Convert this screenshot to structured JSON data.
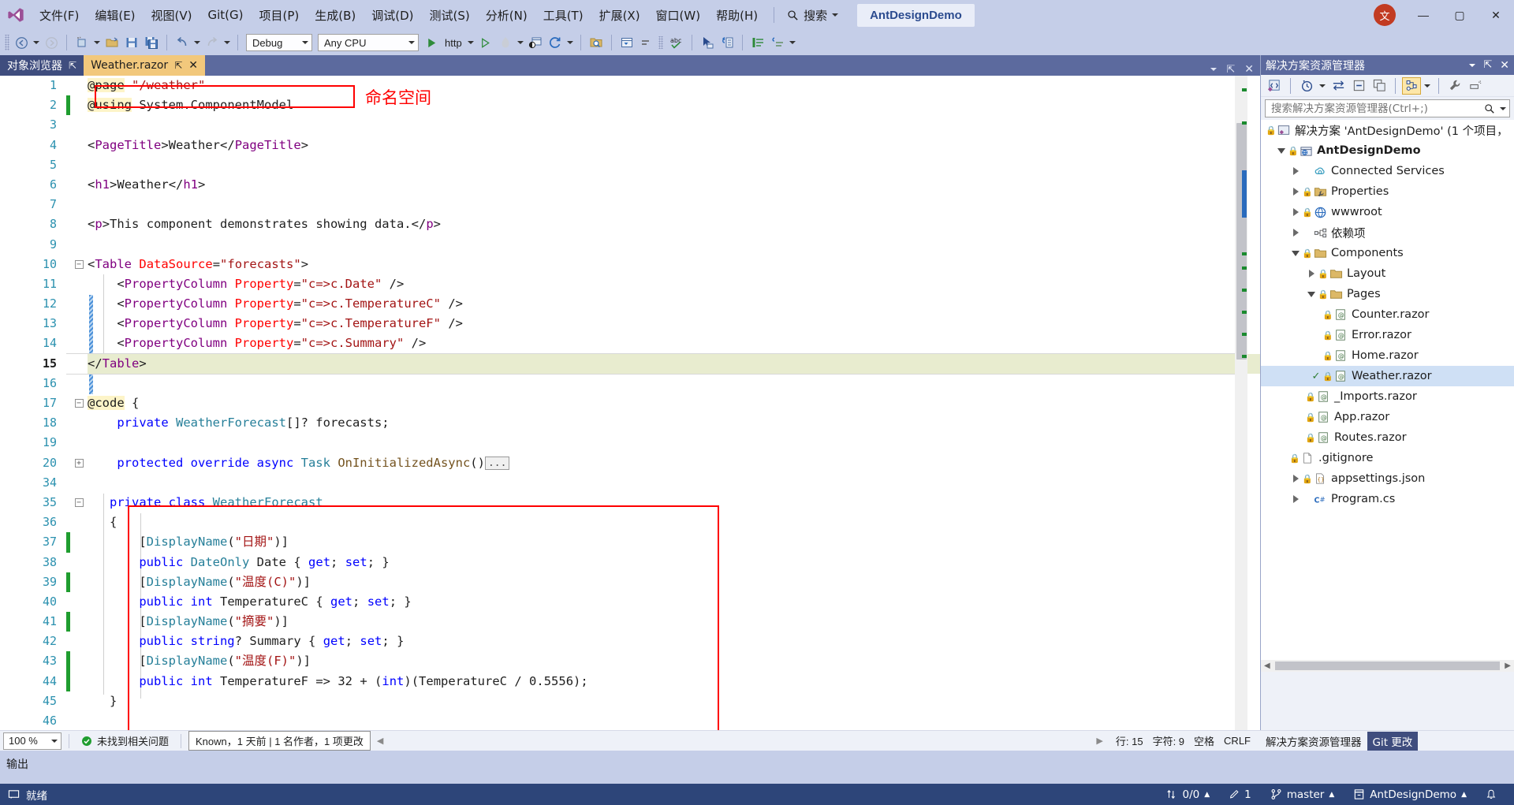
{
  "titlebar": {
    "menus": [
      {
        "label": "文件(F)"
      },
      {
        "label": "编辑(E)"
      },
      {
        "label": "视图(V)"
      },
      {
        "label": "Git(G)"
      },
      {
        "label": "项目(P)"
      },
      {
        "label": "生成(B)"
      },
      {
        "label": "调试(D)"
      },
      {
        "label": "测试(S)"
      },
      {
        "label": "分析(N)"
      },
      {
        "label": "工具(T)"
      },
      {
        "label": "扩展(X)"
      },
      {
        "label": "窗口(W)"
      },
      {
        "label": "帮助(H)"
      }
    ],
    "search_label": "搜索",
    "solution_chip": "AntDesignDemo",
    "user_initial": "文",
    "minimize": "—",
    "maximize": "▢",
    "close": "✕"
  },
  "toolbar": {
    "configuration": "Debug",
    "platform": "Any CPU",
    "run_target": "http"
  },
  "tabs": [
    {
      "label": "对象浏览器",
      "state": "inactive",
      "pin": "⇱",
      "close": ""
    },
    {
      "label": "Weather.razor",
      "state": "active",
      "pin": "⇱",
      "close": "✕"
    }
  ],
  "code": {
    "lines": [
      {
        "n": "1",
        "changed": false,
        "fold": "",
        "text": "@page \"/weather\""
      },
      {
        "n": "2",
        "changed": true,
        "fold": "",
        "text": "@using System.ComponentModel"
      },
      {
        "n": "3",
        "changed": false,
        "fold": "",
        "text": ""
      },
      {
        "n": "4",
        "changed": false,
        "fold": "",
        "text": "<PageTitle>Weather</PageTitle>"
      },
      {
        "n": "5",
        "changed": false,
        "fold": "",
        "text": ""
      },
      {
        "n": "6",
        "changed": false,
        "fold": "",
        "text": "<h1>Weather</h1>"
      },
      {
        "n": "7",
        "changed": false,
        "fold": "",
        "text": ""
      },
      {
        "n": "8",
        "changed": false,
        "fold": "",
        "text": "<p>This component demonstrates showing data.</p>"
      },
      {
        "n": "9",
        "changed": false,
        "fold": "",
        "text": ""
      },
      {
        "n": "10",
        "changed": false,
        "fold": "minus",
        "text": "<Table DataSource=\"forecasts\">"
      },
      {
        "n": "11",
        "changed": false,
        "fold": "",
        "text": "    <PropertyColumn Property=\"c=>c.Date\" />"
      },
      {
        "n": "12",
        "changed": false,
        "fold": "",
        "text": "    <PropertyColumn Property=\"c=>c.TemperatureC\" />"
      },
      {
        "n": "13",
        "changed": false,
        "fold": "",
        "text": "    <PropertyColumn Property=\"c=>c.TemperatureF\" />"
      },
      {
        "n": "14",
        "changed": false,
        "fold": "",
        "text": "    <PropertyColumn Property=\"c=>c.Summary\" />"
      },
      {
        "n": "15",
        "changed": false,
        "fold": "",
        "text": "</Table>"
      },
      {
        "n": "16",
        "changed": false,
        "fold": "",
        "text": ""
      },
      {
        "n": "17",
        "changed": false,
        "fold": "minus",
        "text": "@code {"
      },
      {
        "n": "18",
        "changed": false,
        "fold": "",
        "text": "    private WeatherForecast[]? forecasts;"
      },
      {
        "n": "19",
        "changed": false,
        "fold": "",
        "text": ""
      },
      {
        "n": "20",
        "changed": false,
        "fold": "plus",
        "text": "    protected override async Task OnInitializedAsync()..."
      },
      {
        "n": "34",
        "changed": false,
        "fold": "",
        "text": ""
      },
      {
        "n": "35",
        "changed": false,
        "fold": "minus",
        "text": "    private class WeatherForecast"
      },
      {
        "n": "36",
        "changed": false,
        "fold": "",
        "text": "    {"
      },
      {
        "n": "37",
        "changed": true,
        "fold": "",
        "text": "        [DisplayName(\"日期\")]"
      },
      {
        "n": "38",
        "changed": false,
        "fold": "",
        "text": "        public DateOnly Date { get; set; }"
      },
      {
        "n": "39",
        "changed": true,
        "fold": "",
        "text": "        [DisplayName(\"温度(C)\")]"
      },
      {
        "n": "40",
        "changed": false,
        "fold": "",
        "text": "        public int TemperatureC { get; set; }"
      },
      {
        "n": "41",
        "changed": true,
        "fold": "",
        "text": "        [DisplayName(\"摘要\")]"
      },
      {
        "n": "42",
        "changed": false,
        "fold": "",
        "text": "        public string? Summary { get; set; }"
      },
      {
        "n": "43",
        "changed": true,
        "fold": "",
        "text": "        [DisplayName(\"温度(F)\")]"
      },
      {
        "n": "44",
        "changed": true,
        "fold": "",
        "text": "        public int TemperatureF => 32 + (int)(TemperatureC / 0.5556);"
      },
      {
        "n": "45",
        "changed": false,
        "fold": "",
        "text": "    }"
      },
      {
        "n": "46",
        "changed": false,
        "fold": "",
        "text": ""
      }
    ]
  },
  "annotations": {
    "namespace_note": "命名空间"
  },
  "editor_status": {
    "zoom": "100 %",
    "issues": "未找到相关问题",
    "git_known": "Known，1 天前 | 1 名作者，1 项更改",
    "line": "行: 15",
    "column": "字符: 9",
    "spaces": "空格",
    "line_ending": "CRLF"
  },
  "solution_explorer": {
    "title": "解决方案资源管理器",
    "search_placeholder": "搜索解决方案资源管理器(Ctrl+;)",
    "tree": [
      {
        "indent": 0,
        "twisty": "none",
        "lock": true,
        "icon": "solution-icon",
        "label": "解决方案 'AntDesignDemo' (1 个项目，",
        "bold": false,
        "selected": false
      },
      {
        "indent": 1,
        "twisty": "open",
        "lock": true,
        "icon": "web-project-icon",
        "label": "AntDesignDemo",
        "bold": true,
        "selected": false
      },
      {
        "indent": 2,
        "twisty": "closed",
        "lock": false,
        "icon": "cloud-icon",
        "label": "Connected Services",
        "bold": false,
        "selected": false
      },
      {
        "indent": 2,
        "twisty": "closed",
        "lock": true,
        "icon": "properties-icon",
        "label": "Properties",
        "bold": false,
        "selected": false
      },
      {
        "indent": 2,
        "twisty": "closed",
        "lock": true,
        "icon": "globe-icon",
        "label": "wwwroot",
        "bold": false,
        "selected": false
      },
      {
        "indent": 2,
        "twisty": "closed",
        "lock": false,
        "icon": "dependencies-icon",
        "label": "依赖项",
        "bold": false,
        "selected": false
      },
      {
        "indent": 2,
        "twisty": "open",
        "lock": true,
        "icon": "folder-icon",
        "label": "Components",
        "bold": false,
        "selected": false
      },
      {
        "indent": 3,
        "twisty": "closed",
        "lock": true,
        "icon": "folder-icon",
        "label": "Layout",
        "bold": false,
        "selected": false
      },
      {
        "indent": 3,
        "twisty": "open",
        "lock": true,
        "icon": "folder-icon",
        "label": "Pages",
        "bold": false,
        "selected": false
      },
      {
        "indent": 4,
        "twisty": "none",
        "lock": true,
        "icon": "razor-icon",
        "label": "Counter.razor",
        "bold": false,
        "selected": false
      },
      {
        "indent": 4,
        "twisty": "none",
        "lock": true,
        "icon": "razor-icon",
        "label": "Error.razor",
        "bold": false,
        "selected": false
      },
      {
        "indent": 4,
        "twisty": "none",
        "lock": true,
        "icon": "razor-icon",
        "label": "Home.razor",
        "bold": false,
        "selected": false
      },
      {
        "indent": 4,
        "twisty": "none",
        "lock": true,
        "icon": "razor-icon",
        "label": "Weather.razor",
        "bold": false,
        "selected": true
      },
      {
        "indent": 3,
        "twisty": "none",
        "lock": true,
        "icon": "razor-icon",
        "label": "_Imports.razor",
        "bold": false,
        "selected": false
      },
      {
        "indent": 3,
        "twisty": "none",
        "lock": true,
        "icon": "razor-icon",
        "label": "App.razor",
        "bold": false,
        "selected": false
      },
      {
        "indent": 3,
        "twisty": "none",
        "lock": true,
        "icon": "razor-icon",
        "label": "Routes.razor",
        "bold": false,
        "selected": false
      },
      {
        "indent": 2,
        "twisty": "none",
        "lock": true,
        "icon": "file-icon",
        "label": ".gitignore",
        "bold": false,
        "selected": false
      },
      {
        "indent": 2,
        "twisty": "closed",
        "lock": true,
        "icon": "json-icon",
        "label": "appsettings.json",
        "bold": false,
        "selected": false
      },
      {
        "indent": 2,
        "twisty": "closed",
        "lock": false,
        "icon": "csharp-icon",
        "label": "Program.cs",
        "bold": false,
        "selected": false
      }
    ],
    "bottom_tabs": [
      {
        "label": "解决方案资源管理器",
        "active": false
      },
      {
        "label": "Git 更改",
        "active": true
      }
    ]
  },
  "output": {
    "label": "输出"
  },
  "statusbar": {
    "ready": "就绪",
    "sync": "0/0",
    "pending_edits": "1",
    "branch": "master",
    "repository": "AntDesignDemo"
  }
}
